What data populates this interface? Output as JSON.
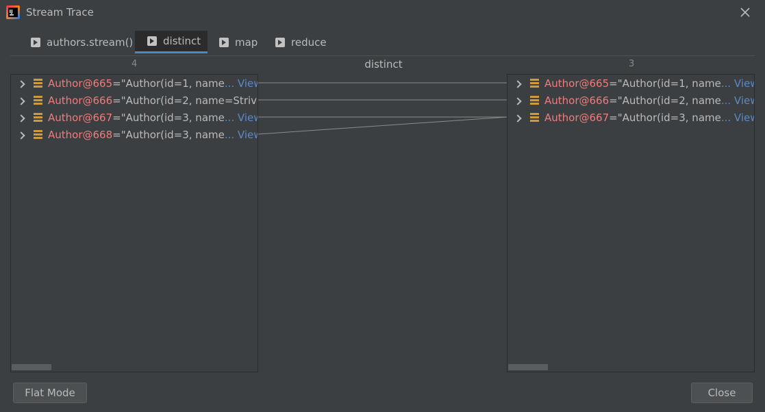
{
  "window": {
    "title": "Stream Trace"
  },
  "tabs": [
    {
      "label": "authors.stream()",
      "active": false
    },
    {
      "label": "distinct",
      "active": true
    },
    {
      "label": "map",
      "active": false
    },
    {
      "label": "reduce",
      "active": false
    }
  ],
  "columns": {
    "left_count": "4",
    "center_title": "distinct",
    "right_count": "3"
  },
  "left_items": [
    {
      "name": "Author@665",
      "eq": " = ",
      "value": "\"Author(id=1, name",
      "view": "... View"
    },
    {
      "name": "Author@666",
      "eq": " = ",
      "value": "\"Author(id=2, name=Strive",
      "view": ""
    },
    {
      "name": "Author@667",
      "eq": " = ",
      "value": "\"Author(id=3, name",
      "view": "... View"
    },
    {
      "name": "Author@668",
      "eq": " = ",
      "value": "\"Author(id=3, name",
      "view": "... View"
    }
  ],
  "right_items": [
    {
      "name": "Author@665",
      "eq": " = ",
      "value": "\"Author(id=1, name",
      "view": "... View"
    },
    {
      "name": "Author@666",
      "eq": " = ",
      "value": "\"Author(id=2, name",
      "view": "... View"
    },
    {
      "name": "Author@667",
      "eq": " = ",
      "value": "\"Author(id=3, name",
      "view": "... View"
    }
  ],
  "mapping": [
    0,
    1,
    2,
    2
  ],
  "buttons": {
    "flat_mode": "Flat Mode",
    "close": "Close"
  },
  "colors": {
    "background": "#3c3f41",
    "object_name": "#f07c7c",
    "link": "#5b8ac6",
    "object_icon": "#d09a3a",
    "active_tab_underline": "#4a88c7",
    "connector": "#8c8c8c"
  },
  "icons": {
    "app": "intellij-idea-icon",
    "close": "close-icon",
    "tab": "stream-op-icon",
    "expand": "chevron-right-icon",
    "object": "object-field-icon"
  }
}
